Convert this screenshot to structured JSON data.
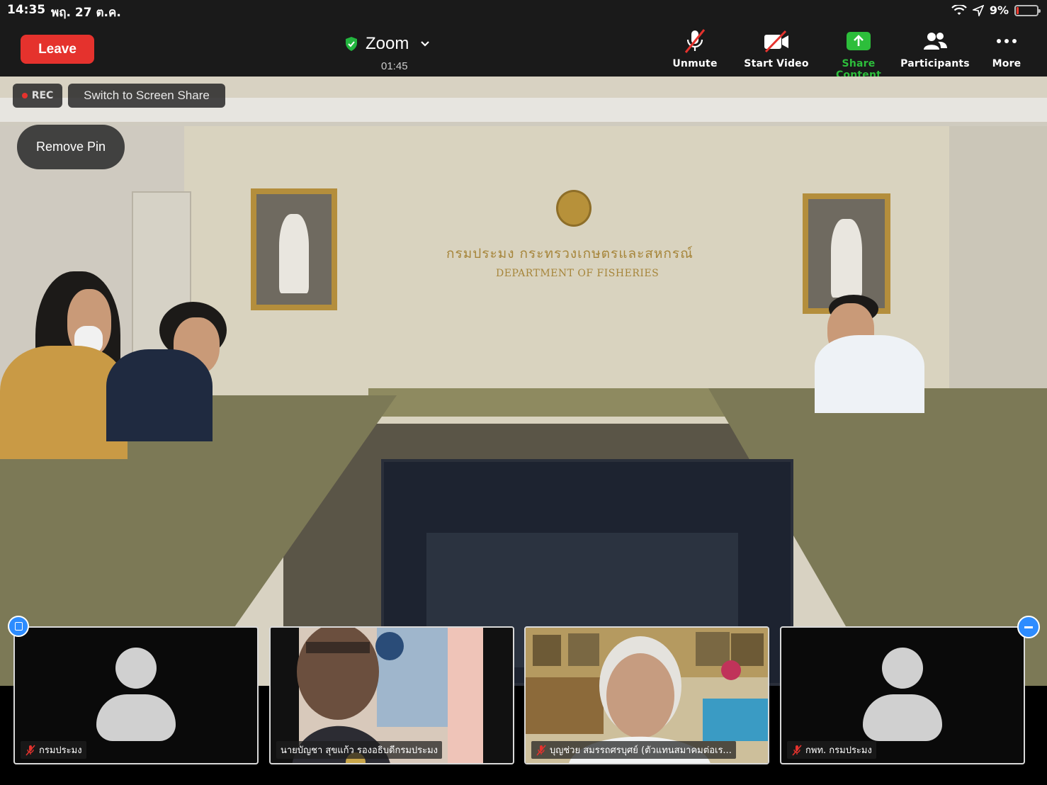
{
  "status_bar": {
    "time": "14:35",
    "date": "พฤ. 27 ต.ค.",
    "battery_text": "9%",
    "battery_level": 0.09
  },
  "toolbar": {
    "leave_label": "Leave",
    "meeting_title": "Zoom",
    "timer": "01:45",
    "unmute_label": "Unmute",
    "start_video_label": "Start Video",
    "share_content_label": "Share Content",
    "participants_label": "Participants",
    "more_label": "More"
  },
  "overlay": {
    "rec_label": "REC",
    "switch_label": "Switch to Screen Share",
    "remove_pin_label": "Remove Pin"
  },
  "room": {
    "wall_line1": "กรมประมง กระทรวงเกษตรและสหกรณ์",
    "wall_line2": "DEPARTMENT OF FISHERIES"
  },
  "participants": [
    {
      "name": "กรมประมง",
      "muted": true,
      "video": false
    },
    {
      "name": "นายบัญชา สุขแก้ว รองอธิบดีกรมประมง",
      "muted": false,
      "video": true
    },
    {
      "name": "บุญช่วย สมรรถศรบุศย์ (ตัวแทนสมาคมต่อเร...",
      "muted": true,
      "video": true
    },
    {
      "name": "กพท. กรมประมง",
      "muted": true,
      "video": false
    }
  ],
  "colors": {
    "leave_red": "#e5322d",
    "share_green": "#2dbe3b",
    "accent_blue": "#2d8cff"
  }
}
